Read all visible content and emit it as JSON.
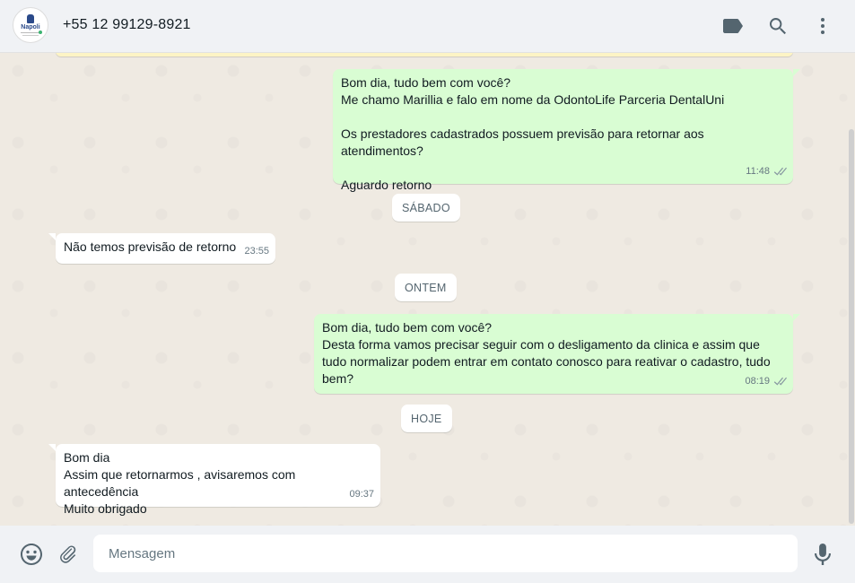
{
  "header": {
    "avatar_text": "Napoli",
    "contact_name": "+55 12 99129-8921",
    "icons": [
      "label-icon",
      "search-icon",
      "menu-icon"
    ]
  },
  "messages": [
    {
      "direction": "out",
      "text": "Bom dia, tudo bem com você?\nMe chamo Marillia e falo em nome da OdontoLife Parceria DentalUni\n\nOs prestadores cadastrados possuem previsão para retornar aos atendimentos?\n\nAguardo retorno",
      "time": "11:48",
      "status": "read"
    },
    {
      "type": "day",
      "label": "SÁBADO"
    },
    {
      "direction": "in",
      "text": "Não temos previsão de retorno",
      "time": "23:55"
    },
    {
      "type": "day",
      "label": "ONTEM"
    },
    {
      "direction": "out",
      "text": "Bom dia, tudo bem com você?\nDesta forma vamos precisar seguir com o desligamento da clinica e assim que\ntudo normalizar podem entrar em contato conosco para reativar o cadastro, tudo\nbem?",
      "time": "08:19",
      "status": "read"
    },
    {
      "type": "day",
      "label": "HOJE"
    },
    {
      "direction": "in",
      "text": "Bom dia\nAssim que retornarmos , avisaremos com antecedência\nMuito obrigado",
      "time": "09:37"
    }
  ],
  "footer": {
    "placeholder": "Mensagem",
    "value": "",
    "icons": [
      "emoji-icon",
      "attach-icon",
      "mic-icon"
    ]
  },
  "colors": {
    "outgoing_bubble": "#d9fdd3",
    "incoming_bubble": "#ffffff",
    "chat_background": "#efeae2",
    "header_background": "#f0f2f5",
    "read_ticks": "#667781"
  }
}
